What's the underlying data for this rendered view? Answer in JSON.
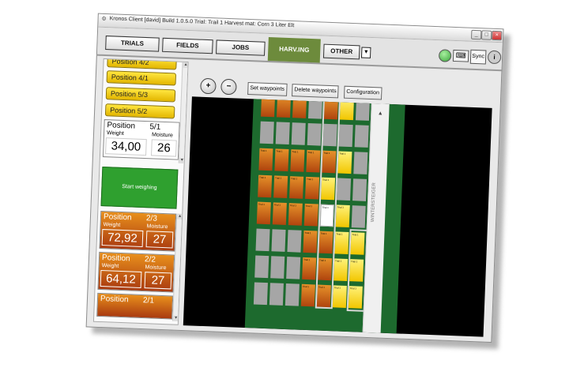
{
  "window": {
    "title": "Kronos Client [david] Build 1.0.5.0     Trial: Trail 1     Harvest mat: Corn 3 Liter Elt",
    "controls": {
      "minimize": "_",
      "maximize": "□",
      "close": "×"
    }
  },
  "tabs": [
    {
      "label": "TRIALS"
    },
    {
      "label": "FIELDS"
    },
    {
      "label": "JOBS"
    },
    {
      "label": "HARV.ING"
    },
    {
      "label": "OTHER"
    }
  ],
  "header_right": {
    "sync_label": "Sync",
    "info_label": "i",
    "keyboard_glyph": "⌨",
    "status_color": "#3aa53a"
  },
  "left_panel": {
    "position_buttons": [
      {
        "label": "Position  4/2"
      },
      {
        "label": "Position  4/1"
      },
      {
        "label": "Position  5/3"
      },
      {
        "label": "Position  5/2"
      }
    ],
    "current_card": {
      "title": "Position",
      "pos": "5/1",
      "weight_label": "Weight",
      "moisture_label": "Moisture",
      "weight": "34,00",
      "moisture": "26"
    },
    "start_button": "Start weighing",
    "result_cards": [
      {
        "title": "Position",
        "pos": "2/3",
        "weight_label": "Weight",
        "moisture_label": "Moisture",
        "weight": "72,92",
        "moisture": "27"
      },
      {
        "title": "Position",
        "pos": "2/2",
        "weight_label": "Weight",
        "moisture_label": "Moisture",
        "weight": "64,12",
        "moisture": "27"
      },
      {
        "title": "Position",
        "pos": "2/1"
      }
    ]
  },
  "toolbar": {
    "zoom_in": "+",
    "zoom_out": "−",
    "set_waypoints": "Set waypoints",
    "delete_waypoints": "Delete waypoints",
    "configuration": "Configuration"
  },
  "map": {
    "field_color": "#1d6a2e",
    "plot_text": "Trial 1",
    "watermark": "WINTERSTEIGER"
  }
}
